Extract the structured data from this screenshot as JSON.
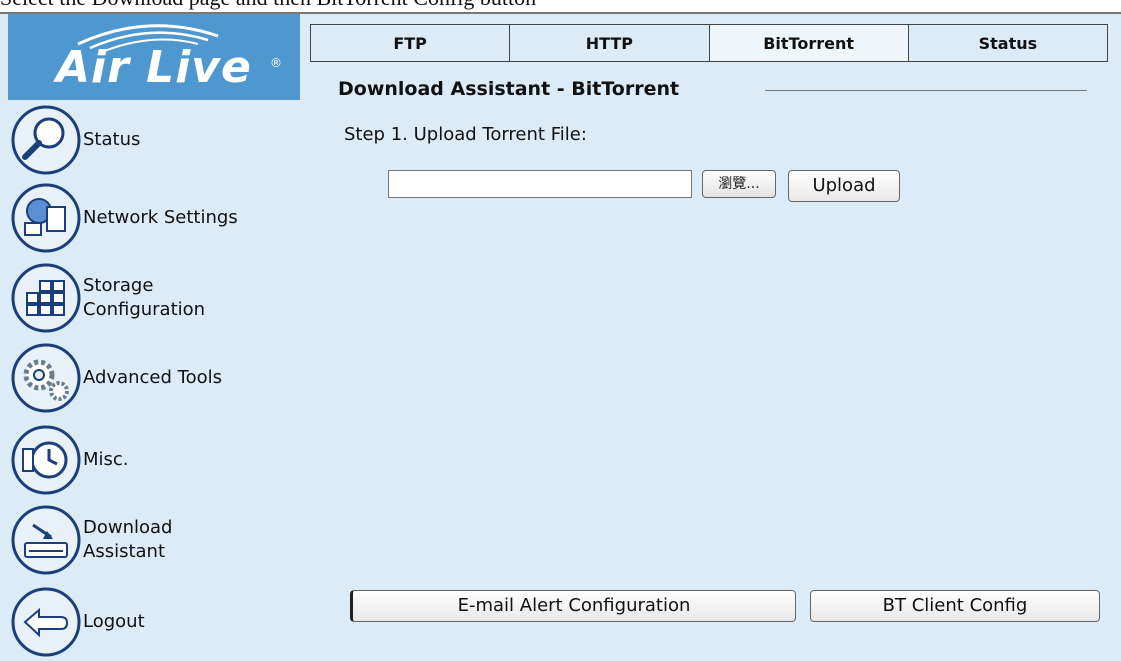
{
  "caption": {
    "text": "Select the Download page and then BitTorrent Config button"
  },
  "logo": {
    "text": "Air Live",
    "reg_mark": "®"
  },
  "nav": {
    "items": [
      {
        "label": "Status",
        "icon": "magnifier-icon"
      },
      {
        "label": "Network Settings",
        "icon": "network-icon"
      },
      {
        "label": "Storage\nConfiguration",
        "icon": "storage-grid-icon"
      },
      {
        "label": "Advanced Tools",
        "icon": "gears-icon"
      },
      {
        "label": "Misc.",
        "icon": "clock-icon"
      },
      {
        "label": "Download\nAssistant",
        "icon": "download-tray-icon"
      },
      {
        "label": "Logout",
        "icon": "back-arrow-icon"
      }
    ]
  },
  "tabs": [
    {
      "label": "FTP"
    },
    {
      "label": "HTTP"
    },
    {
      "label": "BitTorrent"
    },
    {
      "label": "Status"
    }
  ],
  "main": {
    "title": "Download Assistant - BitTorrent",
    "step1": "Step 1. Upload Torrent File:",
    "file_value": "",
    "browse_label": "瀏覽...",
    "upload_label": "Upload",
    "email_alert_label": "E-mail Alert Configuration",
    "bt_client_label": "BT Client Config"
  },
  "colors": {
    "background": "#dbecf8",
    "logo_bg": "#4f97cf"
  }
}
